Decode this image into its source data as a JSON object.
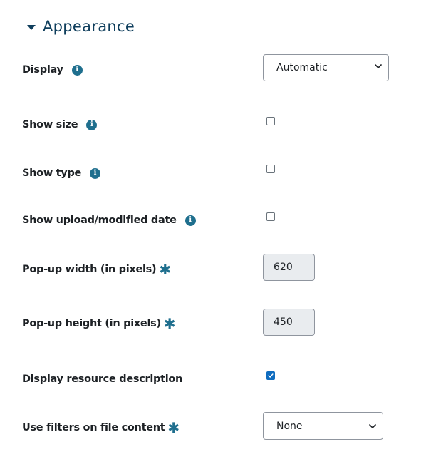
{
  "section": {
    "title": "Appearance"
  },
  "fields": {
    "display": {
      "label": "Display",
      "value": "Automatic"
    },
    "show_size": {
      "label": "Show size",
      "checked": false
    },
    "show_type": {
      "label": "Show type",
      "checked": false
    },
    "show_date": {
      "label": "Show upload/modified date",
      "checked": false
    },
    "popup_width": {
      "label": "Pop-up width (in pixels)",
      "value": "620"
    },
    "popup_height": {
      "label": "Pop-up height (in pixels)",
      "value": "450"
    },
    "display_description": {
      "label": "Display resource description",
      "checked": true
    },
    "filters": {
      "label": "Use filters on file content",
      "value": "None"
    }
  },
  "icons": {
    "info": "info-circle-icon",
    "required": "required-asterisk-icon",
    "dropdown": "chevron-down-icon"
  },
  "colors": {
    "accent": "#0f3e5c",
    "icon": "#1f6f8e",
    "checked": "#0f6cbf",
    "disabled_input": "#e9ecef"
  }
}
